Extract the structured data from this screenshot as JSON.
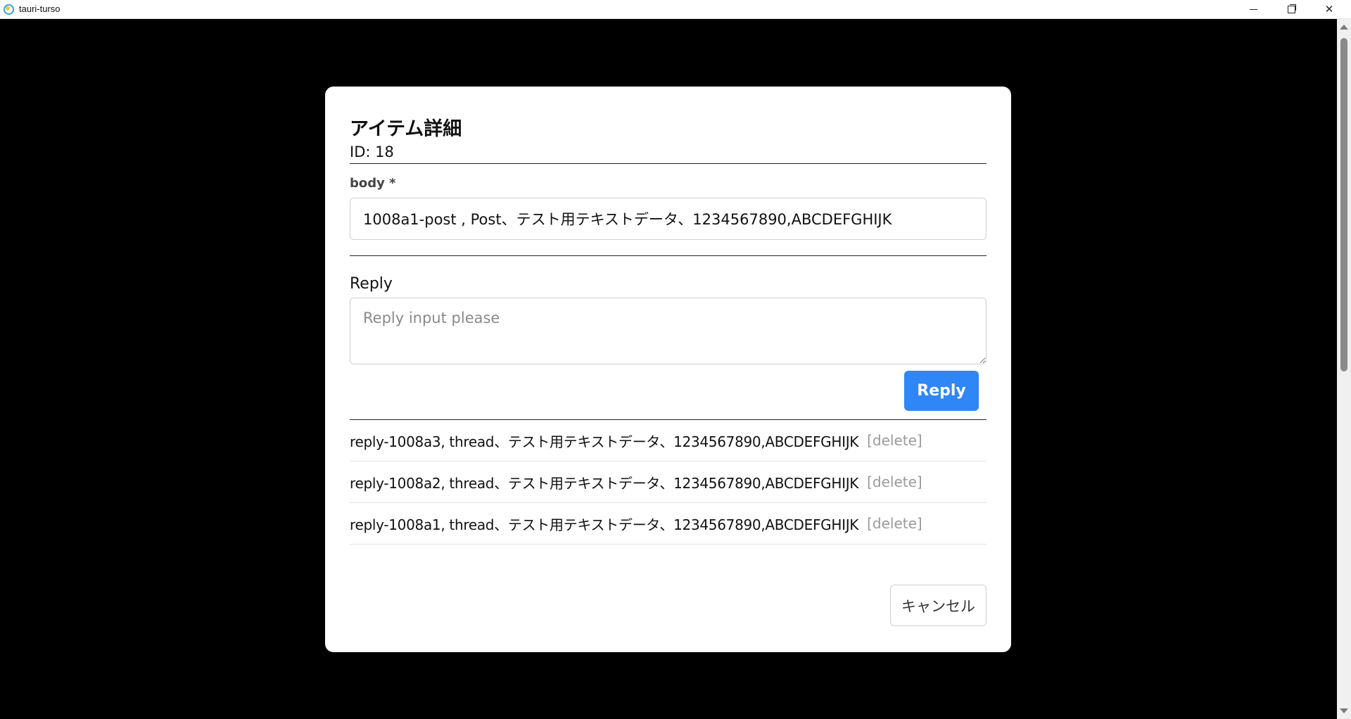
{
  "window": {
    "title": "tauri-turso",
    "icons": {
      "app": "tauri-app-icon",
      "minimize": "minimize-icon",
      "maximize": "restore-icon",
      "close": "close-icon"
    },
    "close_glyph": "✕"
  },
  "modal": {
    "title": "アイテム詳細",
    "id_text": "ID: 18",
    "body_label": "body *",
    "body_value": "1008a1-post , Post、テスト用テキストデータ、1234567890,ABCDEFGHIJK",
    "reply_label": "Reply",
    "reply_placeholder": "Reply input please",
    "reply_button": "Reply",
    "replies": [
      {
        "text": "reply-1008a3, thread、テスト用テキストデータ、1234567890,ABCDEFGHIJK",
        "delete_label": "[delete]"
      },
      {
        "text": "reply-1008a2, thread、テスト用テキストデータ、1234567890,ABCDEFGHIJK",
        "delete_label": "[delete]"
      },
      {
        "text": "reply-1008a1, thread、テスト用テキストデータ、1234567890,ABCDEFGHIJK",
        "delete_label": "[delete]"
      }
    ],
    "cancel_button": "キャンセル"
  },
  "colors": {
    "primary_button": "#2f86f6",
    "backdrop": "#000000",
    "muted_link": "#9a9a9a"
  }
}
